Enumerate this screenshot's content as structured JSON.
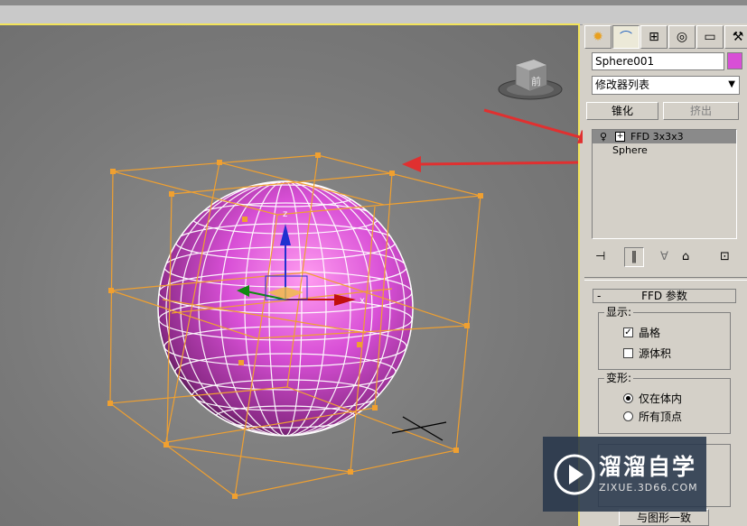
{
  "panel": {
    "tabs": [
      {
        "icon": "create-icon"
      },
      {
        "icon": "modify-icon"
      },
      {
        "icon": "hierarchy-icon"
      },
      {
        "icon": "motion-icon"
      },
      {
        "icon": "display-icon"
      },
      {
        "icon": "utilities-icon"
      }
    ],
    "object_name": "Sphere001",
    "object_color": "#d84fd6",
    "modifier_list": "修改器列表",
    "buttons": {
      "taper": "锥化",
      "extrude": "挤出"
    },
    "stack": {
      "items": [
        {
          "label": "FFD 3x3x3",
          "selected": true
        },
        {
          "label": "Sphere",
          "selected": false
        }
      ]
    },
    "rollout": {
      "title": "FFD 参数",
      "collapse": "-",
      "display_group": "显示:",
      "lattice": "晶格",
      "lattice_checked": true,
      "source_volume": "源体积",
      "source_volume_checked": false,
      "deform_group": "变形:",
      "only_in_volume": "仅在体内",
      "all_vertices": "所有顶点",
      "bottom_button": "与图形一致"
    }
  },
  "viewcube": {
    "face": "前"
  },
  "watermark": {
    "brand": "溜溜自学",
    "url": "ZIXUE.3D66.COM"
  },
  "colors": {
    "accent": "#f2e35a",
    "lattice": "#f0a030",
    "arrow": "#e03030"
  }
}
